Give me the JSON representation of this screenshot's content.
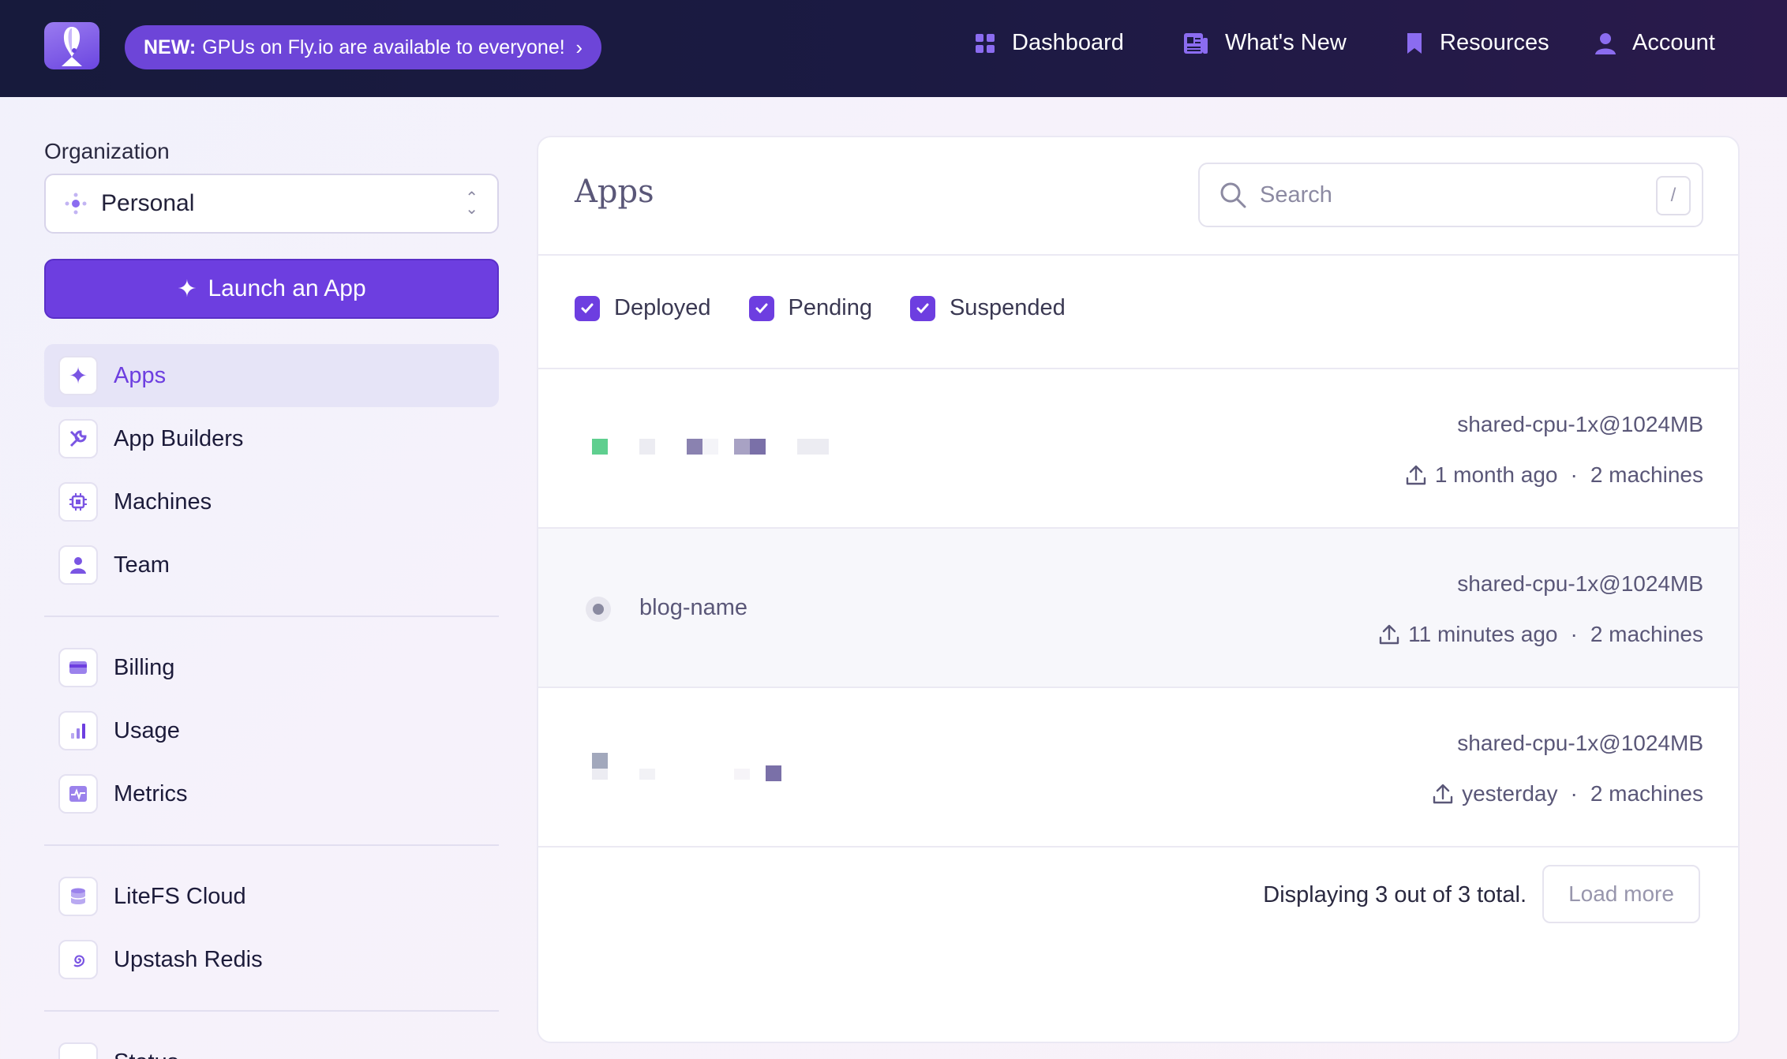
{
  "topbar": {
    "promo_prefix": "NEW:",
    "promo_text": "GPUs on Fly.io are available to everyone!",
    "nav": [
      {
        "label": "Dashboard",
        "icon": "grid-icon"
      },
      {
        "label": "What's New",
        "icon": "newspaper-icon"
      },
      {
        "label": "Resources",
        "icon": "bookmark-icon"
      },
      {
        "label": "Account",
        "icon": "user-icon"
      }
    ]
  },
  "sidebar": {
    "org_label": "Organization",
    "org_value": "Personal",
    "launch_label": "Launch an App",
    "items": [
      {
        "label": "Apps",
        "icon": "sparkle-icon",
        "active": true
      },
      {
        "label": "App Builders",
        "icon": "wrench-icon"
      },
      {
        "label": "Machines",
        "icon": "chip-icon"
      },
      {
        "label": "Team",
        "icon": "users-icon"
      },
      {
        "label": "Billing",
        "icon": "credit-card-icon"
      },
      {
        "label": "Usage",
        "icon": "bar-chart-icon"
      },
      {
        "label": "Metrics",
        "icon": "pulse-icon"
      },
      {
        "label": "LiteFS Cloud",
        "icon": "database-icon"
      },
      {
        "label": "Upstash Redis",
        "icon": "spiral-icon"
      },
      {
        "label": "Status",
        "icon": "status-icon"
      }
    ]
  },
  "main": {
    "title": "Apps",
    "search_placeholder": "Search",
    "search_shortcut": "/",
    "filters": [
      "Deployed",
      "Pending",
      "Suspended"
    ],
    "apps": [
      {
        "name": "",
        "spec": "shared-cpu-1x@1024MB",
        "updated": "1 month ago",
        "machines": "2 machines"
      },
      {
        "name": "blog-name",
        "spec": "shared-cpu-1x@1024MB",
        "updated": "11 minutes ago",
        "machines": "2 machines"
      },
      {
        "name": "",
        "spec": "shared-cpu-1x@1024MB",
        "updated": "yesterday",
        "machines": "2 machines"
      }
    ],
    "separator": "·",
    "footer_text": "Displaying 3 out of 3 total.",
    "load_more": "Load more"
  },
  "colors": {
    "accent": "#6d3ee0",
    "topbar": "#1b1a42",
    "deployed": "#5fcf8f"
  }
}
